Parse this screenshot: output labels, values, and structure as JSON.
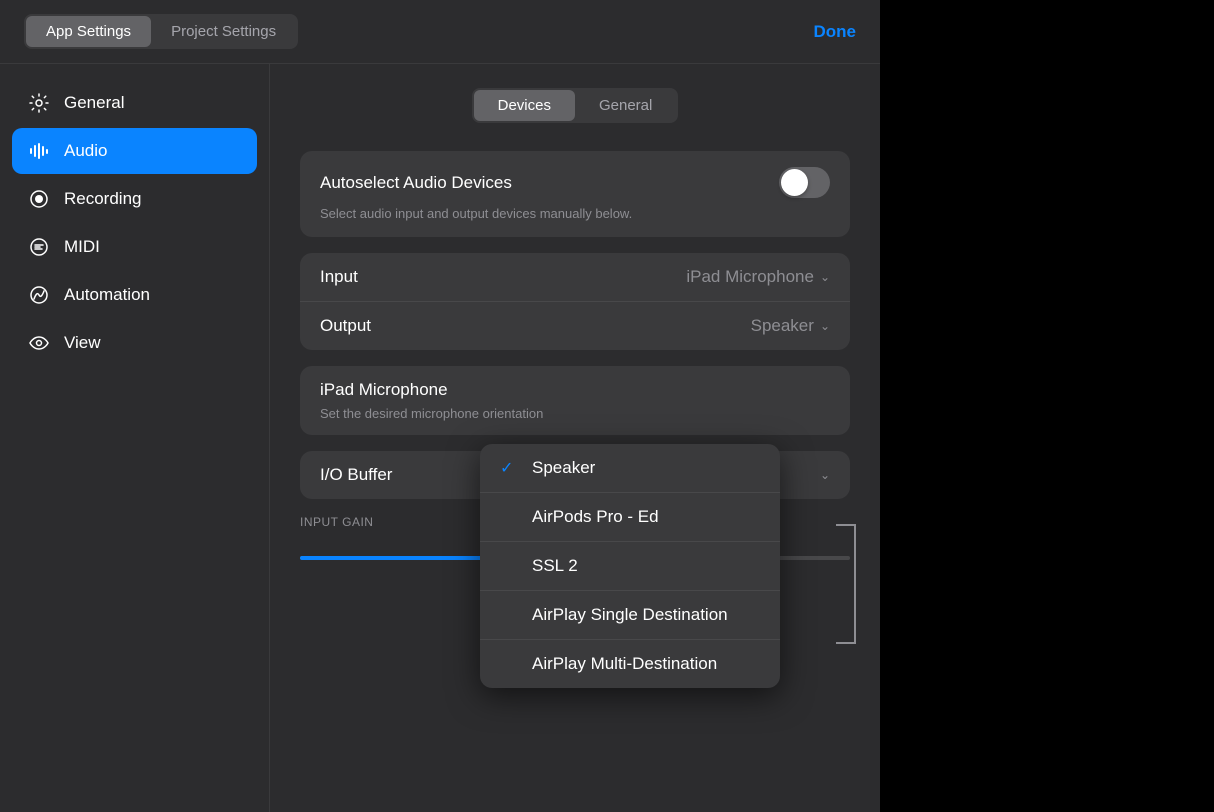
{
  "topbar": {
    "app_settings_label": "App Settings",
    "project_settings_label": "Project Settings",
    "done_label": "Done"
  },
  "sidebar": {
    "items": [
      {
        "id": "general",
        "label": "General",
        "icon": "gear"
      },
      {
        "id": "audio",
        "label": "Audio",
        "icon": "waveform",
        "active": true
      },
      {
        "id": "recording",
        "label": "Recording",
        "icon": "record-circle"
      },
      {
        "id": "midi",
        "label": "MIDI",
        "icon": "midi"
      },
      {
        "id": "automation",
        "label": "Automation",
        "icon": "automation"
      },
      {
        "id": "view",
        "label": "View",
        "icon": "eye"
      }
    ]
  },
  "subtabs": {
    "devices_label": "Devices",
    "general_label": "General"
  },
  "autoselect": {
    "label": "Autoselect Audio Devices",
    "description": "Select audio input and output devices manually below."
  },
  "input_output": {
    "input_label": "Input",
    "input_value": "iPad Microphone",
    "output_label": "Output",
    "output_value": "Speaker"
  },
  "microphone": {
    "title": "iPad Microphone",
    "description": "Set the desired microphone orientation"
  },
  "io_buffer": {
    "label": "I/O Buffer"
  },
  "input_gain": {
    "label": "INPUT GAIN",
    "slider_percent": 65
  },
  "dropdown": {
    "items": [
      {
        "id": "speaker",
        "label": "Speaker",
        "checked": true
      },
      {
        "id": "airpods",
        "label": "AirPods Pro - Ed",
        "checked": false
      },
      {
        "id": "ssl2",
        "label": "SSL 2",
        "checked": false
      },
      {
        "id": "airplay-single",
        "label": "AirPlay Single Destination",
        "checked": false
      },
      {
        "id": "airplay-multi",
        "label": "AirPlay Multi-Destination",
        "checked": false
      }
    ]
  }
}
